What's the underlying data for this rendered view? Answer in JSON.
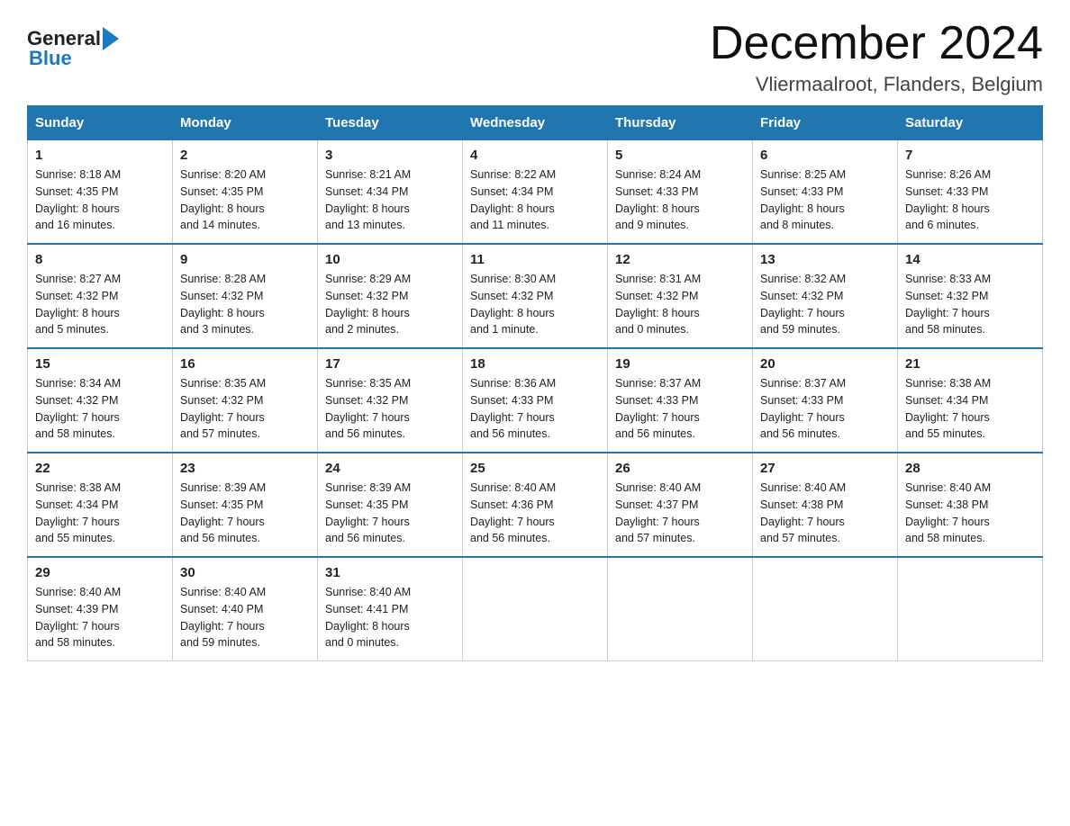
{
  "header": {
    "logo_general": "General",
    "logo_blue": "Blue",
    "title": "December 2024",
    "subtitle": "Vliermaalroot, Flanders, Belgium"
  },
  "weekdays": [
    "Sunday",
    "Monday",
    "Tuesday",
    "Wednesday",
    "Thursday",
    "Friday",
    "Saturday"
  ],
  "weeks": [
    [
      {
        "day": "1",
        "sunrise": "8:18 AM",
        "sunset": "4:35 PM",
        "daylight": "8 hours and 16 minutes."
      },
      {
        "day": "2",
        "sunrise": "8:20 AM",
        "sunset": "4:35 PM",
        "daylight": "8 hours and 14 minutes."
      },
      {
        "day": "3",
        "sunrise": "8:21 AM",
        "sunset": "4:34 PM",
        "daylight": "8 hours and 13 minutes."
      },
      {
        "day": "4",
        "sunrise": "8:22 AM",
        "sunset": "4:34 PM",
        "daylight": "8 hours and 11 minutes."
      },
      {
        "day": "5",
        "sunrise": "8:24 AM",
        "sunset": "4:33 PM",
        "daylight": "8 hours and 9 minutes."
      },
      {
        "day": "6",
        "sunrise": "8:25 AM",
        "sunset": "4:33 PM",
        "daylight": "8 hours and 8 minutes."
      },
      {
        "day": "7",
        "sunrise": "8:26 AM",
        "sunset": "4:33 PM",
        "daylight": "8 hours and 6 minutes."
      }
    ],
    [
      {
        "day": "8",
        "sunrise": "8:27 AM",
        "sunset": "4:32 PM",
        "daylight": "8 hours and 5 minutes."
      },
      {
        "day": "9",
        "sunrise": "8:28 AM",
        "sunset": "4:32 PM",
        "daylight": "8 hours and 3 minutes."
      },
      {
        "day": "10",
        "sunrise": "8:29 AM",
        "sunset": "4:32 PM",
        "daylight": "8 hours and 2 minutes."
      },
      {
        "day": "11",
        "sunrise": "8:30 AM",
        "sunset": "4:32 PM",
        "daylight": "8 hours and 1 minute."
      },
      {
        "day": "12",
        "sunrise": "8:31 AM",
        "sunset": "4:32 PM",
        "daylight": "8 hours and 0 minutes."
      },
      {
        "day": "13",
        "sunrise": "8:32 AM",
        "sunset": "4:32 PM",
        "daylight": "7 hours and 59 minutes."
      },
      {
        "day": "14",
        "sunrise": "8:33 AM",
        "sunset": "4:32 PM",
        "daylight": "7 hours and 58 minutes."
      }
    ],
    [
      {
        "day": "15",
        "sunrise": "8:34 AM",
        "sunset": "4:32 PM",
        "daylight": "7 hours and 58 minutes."
      },
      {
        "day": "16",
        "sunrise": "8:35 AM",
        "sunset": "4:32 PM",
        "daylight": "7 hours and 57 minutes."
      },
      {
        "day": "17",
        "sunrise": "8:35 AM",
        "sunset": "4:32 PM",
        "daylight": "7 hours and 56 minutes."
      },
      {
        "day": "18",
        "sunrise": "8:36 AM",
        "sunset": "4:33 PM",
        "daylight": "7 hours and 56 minutes."
      },
      {
        "day": "19",
        "sunrise": "8:37 AM",
        "sunset": "4:33 PM",
        "daylight": "7 hours and 56 minutes."
      },
      {
        "day": "20",
        "sunrise": "8:37 AM",
        "sunset": "4:33 PM",
        "daylight": "7 hours and 56 minutes."
      },
      {
        "day": "21",
        "sunrise": "8:38 AM",
        "sunset": "4:34 PM",
        "daylight": "7 hours and 55 minutes."
      }
    ],
    [
      {
        "day": "22",
        "sunrise": "8:38 AM",
        "sunset": "4:34 PM",
        "daylight": "7 hours and 55 minutes."
      },
      {
        "day": "23",
        "sunrise": "8:39 AM",
        "sunset": "4:35 PM",
        "daylight": "7 hours and 56 minutes."
      },
      {
        "day": "24",
        "sunrise": "8:39 AM",
        "sunset": "4:35 PM",
        "daylight": "7 hours and 56 minutes."
      },
      {
        "day": "25",
        "sunrise": "8:40 AM",
        "sunset": "4:36 PM",
        "daylight": "7 hours and 56 minutes."
      },
      {
        "day": "26",
        "sunrise": "8:40 AM",
        "sunset": "4:37 PM",
        "daylight": "7 hours and 57 minutes."
      },
      {
        "day": "27",
        "sunrise": "8:40 AM",
        "sunset": "4:38 PM",
        "daylight": "7 hours and 57 minutes."
      },
      {
        "day": "28",
        "sunrise": "8:40 AM",
        "sunset": "4:38 PM",
        "daylight": "7 hours and 58 minutes."
      }
    ],
    [
      {
        "day": "29",
        "sunrise": "8:40 AM",
        "sunset": "4:39 PM",
        "daylight": "7 hours and 58 minutes."
      },
      {
        "day": "30",
        "sunrise": "8:40 AM",
        "sunset": "4:40 PM",
        "daylight": "7 hours and 59 minutes."
      },
      {
        "day": "31",
        "sunrise": "8:40 AM",
        "sunset": "4:41 PM",
        "daylight": "8 hours and 0 minutes."
      },
      null,
      null,
      null,
      null
    ]
  ],
  "labels": {
    "sunrise": "Sunrise:",
    "sunset": "Sunset:",
    "daylight": "Daylight:"
  }
}
